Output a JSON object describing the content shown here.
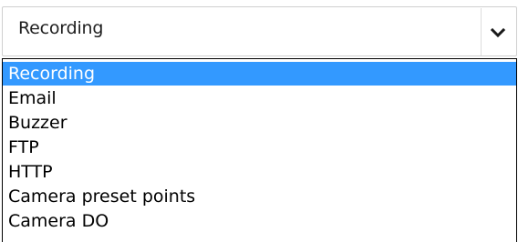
{
  "select": {
    "value": "Recording",
    "toggle_icon": "chevron-down-icon"
  },
  "dropdown": {
    "options": [
      "Recording",
      "Email",
      "Buzzer",
      "FTP",
      "HTTP",
      "Camera preset points",
      "Camera DO"
    ],
    "selected_index": 0,
    "highlight_color": "#3399ff"
  }
}
